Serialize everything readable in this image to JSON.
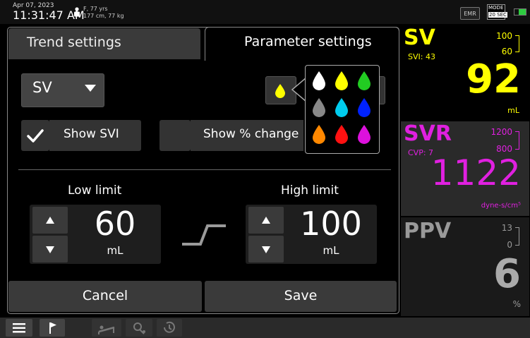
{
  "status_bar": {
    "date": "Apr 07, 2023",
    "time": "11:31:47 AM",
    "patient_line1": "F, 77 yrs",
    "patient_line2": "177 cm, 77 kg",
    "emr_label": "EMR",
    "mode_label": "MODE",
    "mode_value": "20 SEC"
  },
  "tabs": {
    "trend": "Trend settings",
    "parameter": "Parameter settings"
  },
  "parameter_select": {
    "value": "SV"
  },
  "checkboxes": {
    "show_svi": "Show SVI",
    "show_svi_checked": true,
    "show_pct_change": "Show % change",
    "show_pct_change_checked": false
  },
  "limits": {
    "low_title": "Low limit",
    "low_value": "60",
    "low_unit": "mL",
    "high_title": "High limit",
    "high_value": "100",
    "high_unit": "mL"
  },
  "buttons": {
    "cancel": "Cancel",
    "save": "Save"
  },
  "palette": {
    "selected_color": "#ffff00",
    "colors": [
      "#ffffff",
      "#ffff00",
      "#22cc22",
      "#888888",
      "#00ccee",
      "#0022ff",
      "#ff8800",
      "#ff1111",
      "#dd11dd"
    ]
  },
  "tiles": {
    "sv": {
      "name": "SV",
      "sub": "SVI: 43",
      "high": "100",
      "low": "60",
      "value": "92",
      "unit": "mL",
      "color": "#ffff00"
    },
    "svr": {
      "name": "SVR",
      "sub": "CVP: 7",
      "high": "1200",
      "low": "800",
      "value": "1122",
      "unit": "dyne-s/cm⁵",
      "color": "#e020e0"
    },
    "ppv": {
      "name": "PPV",
      "high": "13",
      "low": "0",
      "value": "6",
      "unit": "%",
      "color": "#999999"
    }
  },
  "icons": {
    "menu": "hamburger-icon",
    "flag": "flag-icon",
    "bed": "bed-icon",
    "monitor": "monitor-icon",
    "history": "history-icon"
  }
}
